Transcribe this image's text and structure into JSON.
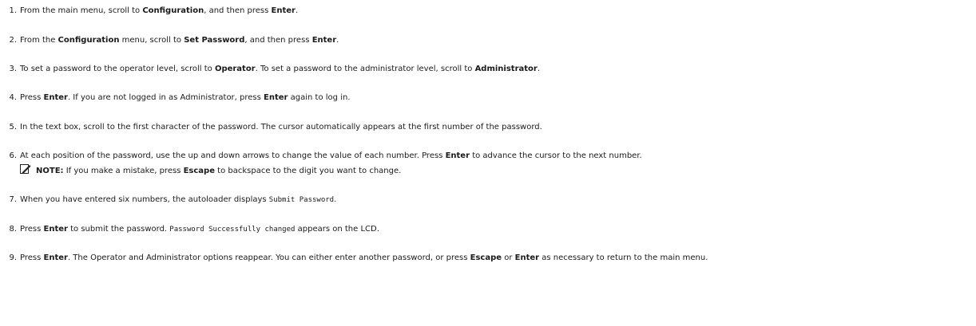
{
  "steps": [
    {
      "num": "1.",
      "t": [
        "From the main menu, scroll to ",
        "Configuration",
        ", and then press ",
        "Enter",
        "."
      ]
    },
    {
      "num": "2.",
      "t": [
        "From the ",
        "Configuration",
        " menu, scroll to ",
        "Set Password",
        ", and then press ",
        "Enter",
        "."
      ]
    },
    {
      "num": "3.",
      "t": [
        "To set a password to the operator level, scroll to ",
        "Operator",
        ". To set a password to the administrator level, scroll to ",
        "Administrator",
        "."
      ]
    },
    {
      "num": "4.",
      "t": [
        "Press ",
        "Enter",
        ". If you are not logged in as Administrator, press ",
        "Enter",
        " again to log in."
      ]
    },
    {
      "num": "5.",
      "t": [
        "In the text box, scroll to the first character of the password. The cursor automatically appears at the first number of the password."
      ]
    },
    {
      "num": "6.",
      "t": [
        "At each position of the password, use the up and down arrows to change the value of each number. Press ",
        "Enter",
        " to advance the cursor to the next number."
      ],
      "note": [
        "NOTE:",
        " If you make a mistake, press ",
        "Escape",
        " to backspace to the digit you want to change."
      ]
    },
    {
      "num": "7.",
      "t": [
        "When you have entered six numbers, the autoloader displays ",
        "Submit Password",
        "."
      ]
    },
    {
      "num": "8.",
      "t": [
        "Press ",
        "Enter",
        " to submit the password. ",
        "Password Successfully changed",
        " appears on the LCD."
      ]
    },
    {
      "num": "9.",
      "t": [
        "Press ",
        "Enter",
        ". The Operator and Administrator options reappear. You can either enter another password, or press ",
        "Escape",
        " or ",
        "Enter",
        " as necessary to return to the main menu."
      ]
    }
  ],
  "colors": {
    "text": "#1a1a1a",
    "note_icon": "#222222"
  },
  "icons": {
    "note": "pencil-note-icon"
  }
}
